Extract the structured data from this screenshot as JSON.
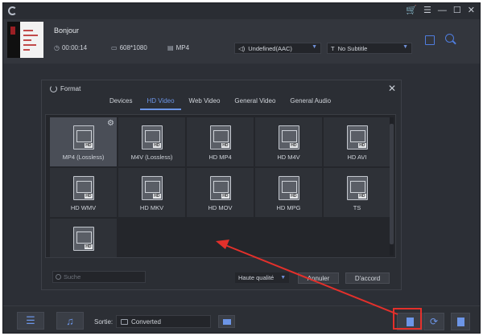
{
  "window": {
    "icons": [
      "cart-icon",
      "menu-icon",
      "minimize-icon",
      "maximize-icon",
      "close-icon"
    ],
    "glyphs": {
      "cart": "🛒",
      "menu": "☰",
      "minimize": "—",
      "maximize": "☐",
      "close": "✕"
    }
  },
  "file": {
    "name": "Bonjour",
    "duration": "00:00:14",
    "resolution": "608*1080",
    "format": "MP4",
    "audio": "Undefined(AAC)",
    "subtitle": "No Subtitle"
  },
  "dialog": {
    "title": "Format",
    "tabs": [
      {
        "label": "Devices",
        "active": false
      },
      {
        "label": "HD Video",
        "active": true
      },
      {
        "label": "Web Video",
        "active": false
      },
      {
        "label": "General Video",
        "active": false
      },
      {
        "label": "General Audio",
        "active": false
      }
    ],
    "formats": [
      {
        "label": "MP4 (Lossless)",
        "selected": true
      },
      {
        "label": "M4V (Lossless)",
        "selected": false
      },
      {
        "label": "HD MP4",
        "selected": false
      },
      {
        "label": "HD M4V",
        "selected": false
      },
      {
        "label": "HD AVI",
        "selected": false
      },
      {
        "label": "HD WMV",
        "selected": false
      },
      {
        "label": "HD MKV",
        "selected": false
      },
      {
        "label": "HD MOV",
        "selected": false
      },
      {
        "label": "HD MPG",
        "selected": false
      },
      {
        "label": "TS",
        "selected": false
      },
      {
        "label": "...",
        "selected": false
      }
    ],
    "search_placeholder": "Suche",
    "quality": "Haute qualité",
    "cancel_label": "Annuler",
    "ok_label": "D'accord",
    "close_glyph": "✕",
    "gear_glyph": "⚙"
  },
  "bottom": {
    "output_label": "Sortie:",
    "output_value": "Converted"
  },
  "colors": {
    "accent": "#6c95e7",
    "highlight": "#e3302b",
    "cart": "#e7a21a"
  }
}
